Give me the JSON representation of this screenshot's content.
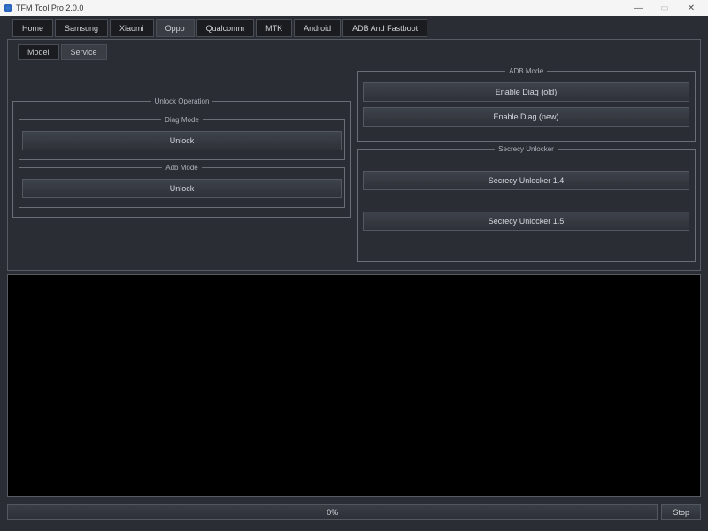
{
  "window": {
    "title": "TFM Tool Pro 2.0.0"
  },
  "tabs": {
    "main": [
      "Home",
      "Samsung",
      "Xiaomi",
      "Oppo",
      "Qualcomm",
      "MTK",
      "Android",
      "ADB And Fastboot"
    ],
    "sub": [
      "Model",
      "Service"
    ]
  },
  "left": {
    "unlock_operation_legend": "Unlock Operation",
    "diag_mode_legend": "Diag Mode",
    "diag_unlock_btn": "Unlock",
    "adb_mode_legend": "Adb Mode",
    "adb_unlock_btn": "Unlock"
  },
  "right": {
    "adb_mode_legend": "ADB Mode",
    "enable_diag_old_btn": "Enable Diag (old)",
    "enable_diag_new_btn": "Enable Diag (new)",
    "secrecy_legend": "Secrecy Unlocker",
    "secrecy_14_btn": "Secrecy Unlocker 1.4",
    "secrecy_15_btn": "Secrecy Unlocker 1.5"
  },
  "bottom": {
    "progress_text": "0%",
    "stop_btn": "Stop"
  }
}
